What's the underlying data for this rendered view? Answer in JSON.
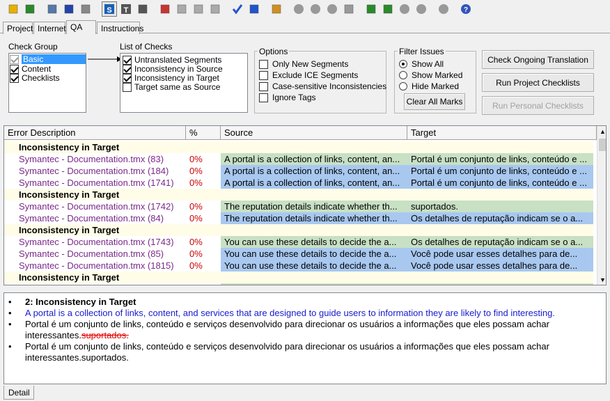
{
  "toolbar_icons": [
    "open-folder-icon",
    "save-icon",
    "import-icon",
    "refresh-icon",
    "document-icon",
    "s-icon",
    "t-icon",
    "list-icon",
    "palette-icon",
    "gray-square-icon",
    "gray-square-icon",
    "gray-square-icon",
    "check-mark-icon",
    "checklist-icon",
    "hand-icon",
    "back-circle-icon",
    "forward-circle-icon",
    "stop-circle-icon",
    "page-icon",
    "undo-icon",
    "redo-icon",
    "zoom-in-icon",
    "zoom-out-icon",
    "globe-icon",
    "help-icon"
  ],
  "tabs": [
    "Project",
    "Internet",
    "QA",
    "Instructions"
  ],
  "check_group": {
    "label": "Check Group",
    "items": [
      {
        "label": "Basic",
        "checked": true,
        "selected": true
      },
      {
        "label": "Content",
        "checked": true
      },
      {
        "label": "Checklists",
        "checked": true
      }
    ]
  },
  "list_of_checks": {
    "label": "List of Checks",
    "items": [
      {
        "label": "Untranslated Segments",
        "checked": true
      },
      {
        "label": "Inconsistency in Source",
        "checked": true
      },
      {
        "label": "Inconsistency in Target",
        "checked": true
      },
      {
        "label": "Target same as Source",
        "checked": false
      }
    ]
  },
  "options": {
    "label": "Options",
    "items": [
      "Only New Segments",
      "Exclude ICE Segments",
      "Case-sensitive Inconsistencies",
      "Ignore Tags"
    ]
  },
  "filter": {
    "label": "Filter Issues",
    "items": [
      {
        "label": "Show All",
        "selected": true
      },
      {
        "label": "Show Marked",
        "selected": false
      },
      {
        "label": "Hide Marked",
        "selected": false
      }
    ],
    "clear_btn": "Clear All Marks"
  },
  "buttons": {
    "check_ongoing": "Check Ongoing Translation",
    "run_project": "Run Project Checklists",
    "run_personal": "Run Personal Checklists"
  },
  "grid": {
    "columns": [
      "Error Description",
      "%",
      "Source",
      "Target"
    ],
    "rows": [
      {
        "type": "header",
        "label": "Inconsistency in Target"
      },
      {
        "type": "item",
        "file": "Symantec - Documentation.tmx (83)",
        "pct": "0%",
        "source": "A portal is a collection of links, content, an...",
        "target": "Portal é um conjunto de links, conteúdo e ...",
        "color": "green"
      },
      {
        "type": "item",
        "file": "Symantec - Documentation.tmx (184)",
        "pct": "0%",
        "source": "A portal is a collection of links, content, an...",
        "target": "Portal é um conjunto de links, conteúdo e ...",
        "color": "blue"
      },
      {
        "type": "item",
        "file": "Symantec - Documentation.tmx (1741)",
        "pct": "0%",
        "source": "A portal is a collection of links, content, an...",
        "target": "Portal é um conjunto de links, conteúdo e ...",
        "color": "blue"
      },
      {
        "type": "header",
        "label": "Inconsistency in Target"
      },
      {
        "type": "item",
        "file": "Symantec - Documentation.tmx (1742)",
        "pct": "0%",
        "source": "The reputation details indicate whether th...",
        "target": "suportados.",
        "color": "green"
      },
      {
        "type": "item",
        "file": "Symantec - Documentation.tmx (84)",
        "pct": "0%",
        "source": "The reputation details indicate whether th...",
        "target": "Os detalhes de reputação indicam se o a...",
        "color": "blue"
      },
      {
        "type": "header",
        "label": "Inconsistency in Target"
      },
      {
        "type": "item",
        "file": "Symantec - Documentation.tmx (1743)",
        "pct": "0%",
        "source": "You can use these details to decide the a...",
        "target": "Os detalhes de reputação indicam se o a...",
        "color": "green"
      },
      {
        "type": "item",
        "file": "Symantec - Documentation.tmx (85)",
        "pct": "0%",
        "source": "You can use these details to decide the a...",
        "target": "Você pode usar esses detalhes para de...",
        "color": "blue"
      },
      {
        "type": "item",
        "file": "Symantec - Documentation.tmx (1815)",
        "pct": "0%",
        "source": "You can use these details to decide the a...",
        "target": "Você pode usar esses detalhes para de...",
        "color": "blue"
      },
      {
        "type": "header",
        "label": "Inconsistency in Target"
      }
    ]
  },
  "detail": {
    "title": "2: Inconsistency in Target",
    "source": "A portal is a collection of links, content, and services that are designed to guide users to information they are likely to find interesting.",
    "target1_line1": "Portal é um conjunto de links, conteúdo e serviços desenvolvido para direcionar os usuários a informações que eles possam achar",
    "target1_line2": "interessantes.",
    "target1_strike": "suportados.",
    "target2_line1": "Portal é um conjunto de links, conteúdo e serviços desenvolvido para direcionar os usuários a informações que eles possam achar",
    "target2_line2": "interessantes.suportados.",
    "tab": "Detail"
  }
}
